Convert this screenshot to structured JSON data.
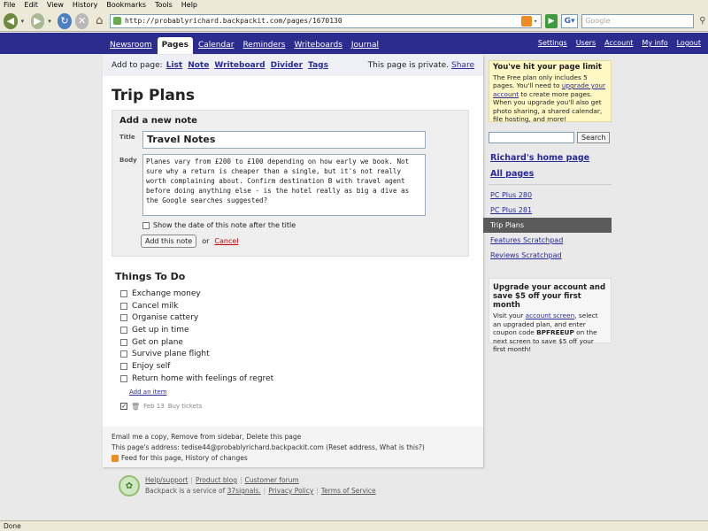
{
  "browser": {
    "menu": [
      "File",
      "Edit",
      "View",
      "History",
      "Bookmarks",
      "Tools",
      "Help"
    ],
    "url": "http://probablyrichard.backpackit.com/pages/1670130",
    "search_placeholder": "Google",
    "status": "Done"
  },
  "nav": {
    "tabs": [
      {
        "label": "Newsroom",
        "active": false
      },
      {
        "label": "Pages",
        "active": true
      },
      {
        "label": "Calendar",
        "active": false
      },
      {
        "label": "Reminders",
        "active": false
      },
      {
        "label": "Writeboards",
        "active": false
      },
      {
        "label": "Journal",
        "active": false
      }
    ],
    "right": [
      "Settings",
      "Users",
      "Account",
      "My info",
      "Logout"
    ]
  },
  "addbar": {
    "label": "Add to page:",
    "links": [
      "List",
      "Note",
      "Writeboard",
      "Divider",
      "Tags"
    ],
    "private_text": "This page is private.",
    "share": "Share"
  },
  "page": {
    "title": "Trip Plans"
  },
  "note_form": {
    "heading": "Add a new note",
    "title_label": "Title",
    "title_value": "Travel Notes",
    "body_label": "Body",
    "body_value": "Planes vary from £200 to £100 depending on how early we book. Not sure why a return is cheaper than a single, but it's not really worth complaining about. Confirm destination B with travel agent before doing anything else - is the hotel really as big a dive as the Google searches suggested?",
    "show_date_label": "Show the date of this note after the title",
    "submit_label": "Add this note",
    "or_text": "or",
    "cancel_label": "Cancel"
  },
  "todo": {
    "title": "Things To Do",
    "items": [
      "Exchange money",
      "Cancel milk",
      "Organise cattery",
      "Get up in time",
      "Get on plane",
      "Survive plane flight",
      "Enjoy self",
      "Return home with feelings of regret"
    ],
    "add_item": "Add an item",
    "done_date": "Feb 13",
    "done_text": "Buy tickets"
  },
  "page_footer": {
    "line1": "Email me a copy, Remove from sidebar, Delete this page",
    "line2": "This page's address: tedise44@probablyrichard.backpackit.com (Reset address, What is this?)",
    "line3": "Feed for this page, History of changes"
  },
  "sidebar": {
    "limit_title": "You've hit your page limit",
    "limit_text_1": "The Free plan only includes 5 pages. You'll need to",
    "limit_link": "upgrade your account",
    "limit_text_2": "to create more pages. When you upgrade you'll also get photo sharing, a shared calendar, file hosting, and more!",
    "search_button": "Search",
    "home_link": "Richard's home page",
    "all_pages": "All pages",
    "pages": [
      {
        "label": "PC Plus 280",
        "current": false
      },
      {
        "label": "PC Plus 281",
        "current": false
      },
      {
        "label": "Trip Plans",
        "current": true
      },
      {
        "label": "Features Scratchpad",
        "current": false
      },
      {
        "label": "Reviews Scratchpad",
        "current": false
      }
    ],
    "upgrade_title": "Upgrade your account and save $5 off your first month",
    "upgrade_text_1": "Visit your",
    "upgrade_link": "account screen",
    "upgrade_text_2": ", select an upgraded plan, and enter coupon code",
    "coupon": "BPFREEUP",
    "upgrade_text_3": "on the next screen to save $5 off your first month!"
  },
  "footer": {
    "links_1": [
      "Help/support",
      "Product blog",
      "Customer forum"
    ],
    "service_text": "Backpack is a service of",
    "company": "37signals.",
    "links_2": [
      "Privacy Policy",
      "Terms of Service"
    ]
  }
}
